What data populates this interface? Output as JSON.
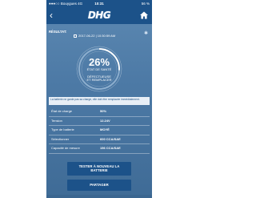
{
  "status_bar": {
    "carrier": "●●●○○ Bouygues 4G",
    "time": "10:31",
    "battery": "56 %"
  },
  "header": {
    "back_icon": "chevron-left-icon",
    "logo": "DHG",
    "home_icon": "home-icon"
  },
  "result": {
    "label": "RÉSULTAT:",
    "date": "2017-06-22 | 10:30:59 AM",
    "bluetooth_icon": "bluetooth-icon"
  },
  "gauge": {
    "percent": "26%",
    "label": "ÉTAT DE SANTÉ",
    "status_line1": "DÉFECTUEUSE",
    "status_line2": "ET REMPLACER",
    "level": 0.26
  },
  "warning": "La batterie ne garde pas sa charge, elle doit être remplacée immédiatement.",
  "details": [
    {
      "label": "État de charge",
      "value": "50%"
    },
    {
      "label": "Tension",
      "value": "12.24V"
    },
    {
      "label": "Type de batterie",
      "value": "MOYÉ"
    },
    {
      "label": "Sélectionner",
      "value": "600 CCA/SAE"
    },
    {
      "label": "Capacité de mesure",
      "value": "156 CCA/SAE"
    }
  ],
  "buttons": {
    "test_again_line1": "TESTER À NOUVEAU LA",
    "test_again_line2": "BATTERIE",
    "share": "PARTAGER"
  },
  "colors": {
    "header": "#1c5289",
    "background": "#4d7aa6",
    "gauge_track": "#8fb0cf",
    "gauge_fill": "#ffffff"
  }
}
